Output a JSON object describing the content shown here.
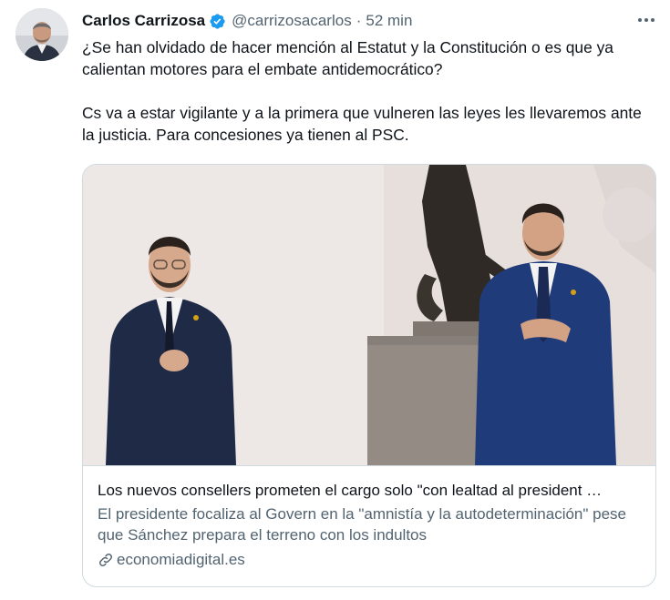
{
  "tweet": {
    "author": {
      "name": "Carlos Carrizosa",
      "handle": "@carrizosacarlos",
      "verified": true,
      "avatar": "author-avatar-photo"
    },
    "separator": "·",
    "time": "52 min",
    "more_icon": "more-dots-icon",
    "text": {
      "paragraph1": "¿Se han olvidado de hacer mención al Estatut y la Constitución o es que ya calientan motores para el embate antidemocrático?",
      "paragraph2": "Cs va a estar vigilante y a la primera que vulneren las leyes les llevaremos ante la justicia. Para concesiones ya tienen al PSC."
    },
    "card": {
      "image": "photo-two-men-applauding-statue",
      "title": "Los nuevos consellers prometen el cargo solo \"con lealtad al president …",
      "description": "El presidente focaliza al Govern en la \"amnistía y la autodeterminación\" pese que Sánchez prepara el terreno con los indultos",
      "domain": "economiadigital.es",
      "domain_icon": "link-icon"
    }
  },
  "colors": {
    "text_primary": "#0f1419",
    "text_secondary": "#536471",
    "verified_blue": "#1d9bf0",
    "border": "#cfd9de"
  }
}
